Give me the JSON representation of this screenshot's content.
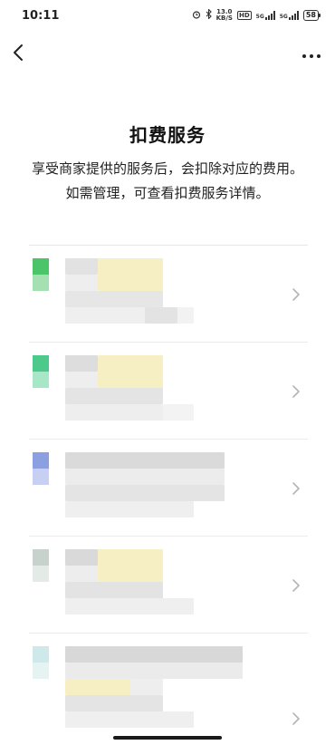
{
  "status_bar": {
    "time": "10:11",
    "network_speed": "13.0",
    "network_unit": "KB/S",
    "hd_label": "HD",
    "signal_label_1": "5G",
    "signal_label_2": "5G",
    "battery": "58"
  },
  "nav": {
    "back_icon": "chevron-left-icon",
    "more_icon": "more-horizontal-icon"
  },
  "page": {
    "title": "扣费服务",
    "description": "享受商家提供的服务后，会扣除对应的费用。如需管理，可查看扣费服务详情。"
  },
  "services": [
    {
      "logo_colors": [
        "#4cc46a",
        "#a5e0b3"
      ],
      "blurred": true
    },
    {
      "logo_colors": [
        "#4cc98b",
        "#a8e6c8"
      ],
      "blurred": true
    },
    {
      "logo_colors": [
        "#8c9fe0",
        "#c7d0f2"
      ],
      "blurred": true
    },
    {
      "logo_colors": [
        "#c8d2cc",
        "#e4ebe7"
      ],
      "blurred": true
    },
    {
      "logo_colors": [
        "#cfe9ea",
        "#e6f3f3"
      ],
      "blurred": true
    }
  ],
  "colors": {
    "background": "#ffffff",
    "text_primary": "#111111",
    "chevron": "#b5b5b5",
    "blur_yellow": "#f7efc4",
    "blur_gray": "#dcdcdc"
  }
}
